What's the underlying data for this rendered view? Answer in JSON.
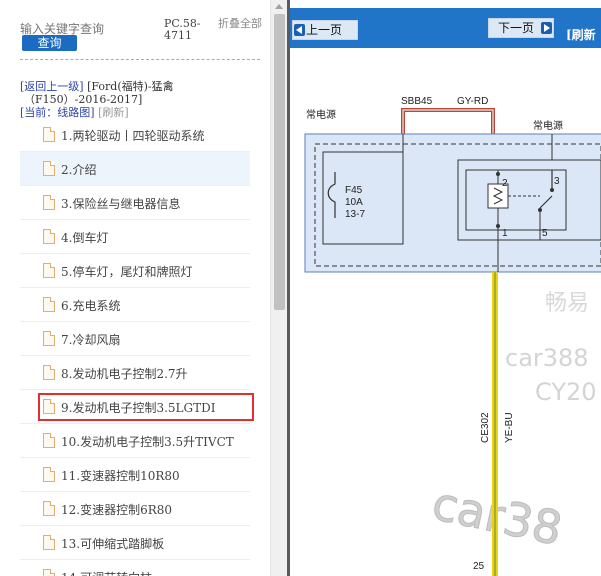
{
  "search": {
    "placeholder": "输入关键字查询",
    "button": "查询"
  },
  "header": {
    "code": "PC.58-4711",
    "fold_all": "折叠全部"
  },
  "nav": {
    "back": "[返回上一级]",
    "brand": "[Ford(福特)-猛禽",
    "model": "（F150）-2016-2017]",
    "current": "[当前：线路图]",
    "refresh": "[刷新]"
  },
  "tree": {
    "items": [
      {
        "label": "1.两轮驱动丨四轮驱动系统"
      },
      {
        "label": "2.介绍"
      },
      {
        "label": "3.保险丝与继电器信息"
      },
      {
        "label": "4.倒车灯"
      },
      {
        "label": "5.停车灯，尾灯和牌照灯"
      },
      {
        "label": "6.充电系统"
      },
      {
        "label": "7.冷却风扇"
      },
      {
        "label": "8.发动机电子控制2.7升"
      },
      {
        "label": "9.发动机电子控制3.5LGTDI"
      },
      {
        "label": "10.发动机电子控制3.5升TIVCT"
      },
      {
        "label": "11.变速器控制10R80"
      },
      {
        "label": "12.变速器控制6R80"
      },
      {
        "label": "13.可伸缩式踏脚板"
      },
      {
        "label": "14.可调节转向柱"
      }
    ],
    "selected_index": 1,
    "highlighted_index": 8
  },
  "viewer": {
    "prev": "上一页",
    "next": "下一页",
    "refresh": "[刷新"
  },
  "diagram": {
    "left_source": "常电源",
    "fuse_wire": "SBB45",
    "wire_color_top": "GY-RD",
    "relay_source": "常电源",
    "fuse_id": "F45",
    "fuse_rating": "10A",
    "fuse_loc": "13-7",
    "pin2": "2",
    "pin3": "3",
    "pin1": "1",
    "pin5": "5",
    "circuit": "CE302",
    "wire_color": "YE-BU",
    "connector": "25",
    "wm1": "畅易",
    "wm2": "car388",
    "wm3": "CY20",
    "wm4": "car38"
  },
  "colors": {
    "toolbar": "#2175c8",
    "search_button": "#1a6bc1",
    "wire_yellow": "#e8d21a",
    "highlight_red": "#e03030",
    "box_blue": "#dbe7f6"
  }
}
